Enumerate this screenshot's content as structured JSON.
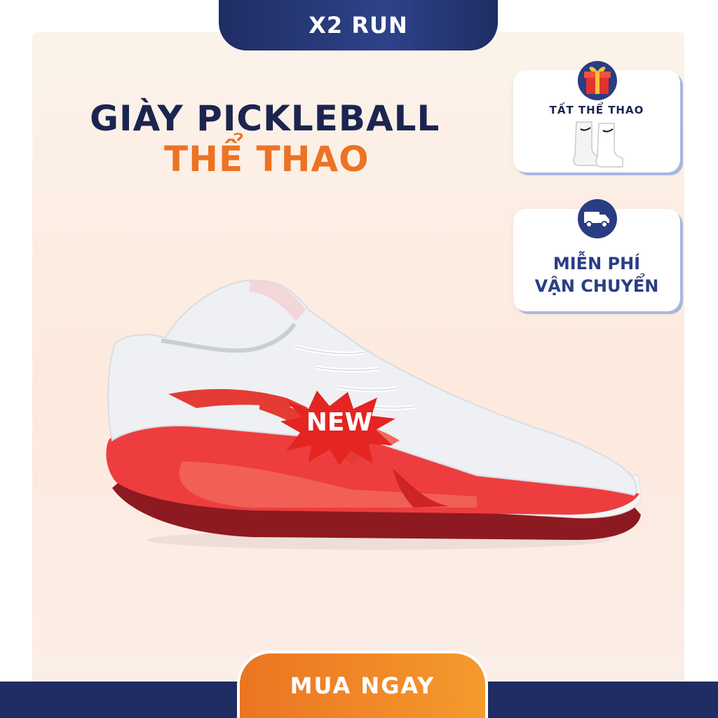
{
  "header": {
    "brand": "X2 RUN"
  },
  "headline": {
    "line1": "GIÀY PICKLEBALL",
    "line2": "THỂ THAO"
  },
  "perks": [
    {
      "label": "TẤT THỂ THAO",
      "icon": "gift-icon"
    },
    {
      "label_line1": "MIỄN PHÍ",
      "label_line2": "VẬN CHUYỂN",
      "icon": "delivery-truck-icon"
    }
  ],
  "badge": {
    "text": "NEW"
  },
  "cta": {
    "label": "MUA NGAY"
  },
  "colors": {
    "navy": "#1f2d64",
    "orange": "#ec7323",
    "red": "#e02a2a"
  }
}
